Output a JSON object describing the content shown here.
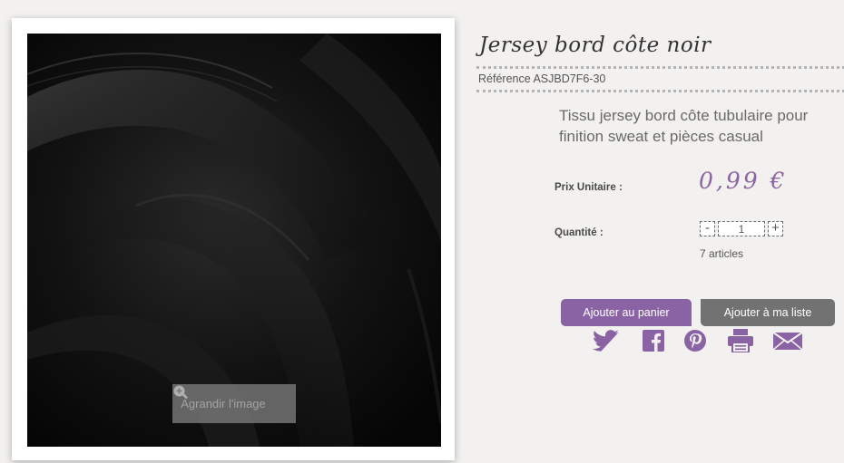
{
  "product": {
    "title": "Jersey bord côte noir",
    "reference": "Référence ASJBD7F6-30",
    "description": "Tissu jersey bord côte tubulaire pour finition sweat et pièces casual",
    "price_label": "Prix Unitaire :",
    "price": "0,99 €",
    "quantity_label": "Quantité :",
    "quantity_value": "1",
    "quantity_decrease": "-",
    "quantity_increase": "+",
    "stock": "7 articles"
  },
  "image": {
    "zoom_label": "Agrandir l'image",
    "zoom_icon": "zoom-in-icon"
  },
  "actions": {
    "add_to_cart": "Ajouter au panier",
    "add_to_list": "Ajouter à ma liste"
  },
  "share": {
    "icons": [
      "twitter-icon",
      "facebook-icon",
      "pinterest-icon",
      "print-icon",
      "email-icon"
    ]
  },
  "colors": {
    "accent": "#8a63a4",
    "secondary_button": "#727272",
    "price": "#8b64a2",
    "background": "#f2f1ef"
  }
}
